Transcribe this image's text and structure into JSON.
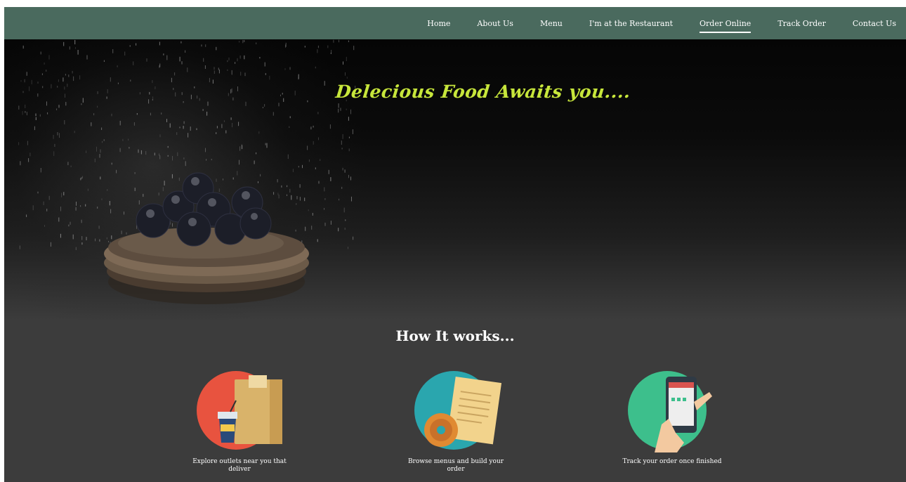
{
  "nav": {
    "items": [
      {
        "label": "Home",
        "active": false
      },
      {
        "label": "About Us",
        "active": false
      },
      {
        "label": "Menu",
        "active": false
      },
      {
        "label": "I'm at the Restaurant",
        "active": false
      },
      {
        "label": "Order Online",
        "active": true
      },
      {
        "label": "Track Order",
        "active": false
      },
      {
        "label": "Contact Us",
        "active": false
      }
    ],
    "background": "#4a6a5e"
  },
  "hero": {
    "title": "Delecious Food Awaits you....",
    "title_color": "#c7e63b",
    "image": "pancake-stack-with-blueberries"
  },
  "how_it_works": {
    "title": "How It works...",
    "steps": [
      {
        "icon": "shopping-bag-icon",
        "caption": "Explore outlets near you that deliver"
      },
      {
        "icon": "menu-document-icon",
        "caption": "Browse menus and build your order"
      },
      {
        "icon": "phone-tracking-icon",
        "caption": "Track your order once finished"
      }
    ]
  }
}
